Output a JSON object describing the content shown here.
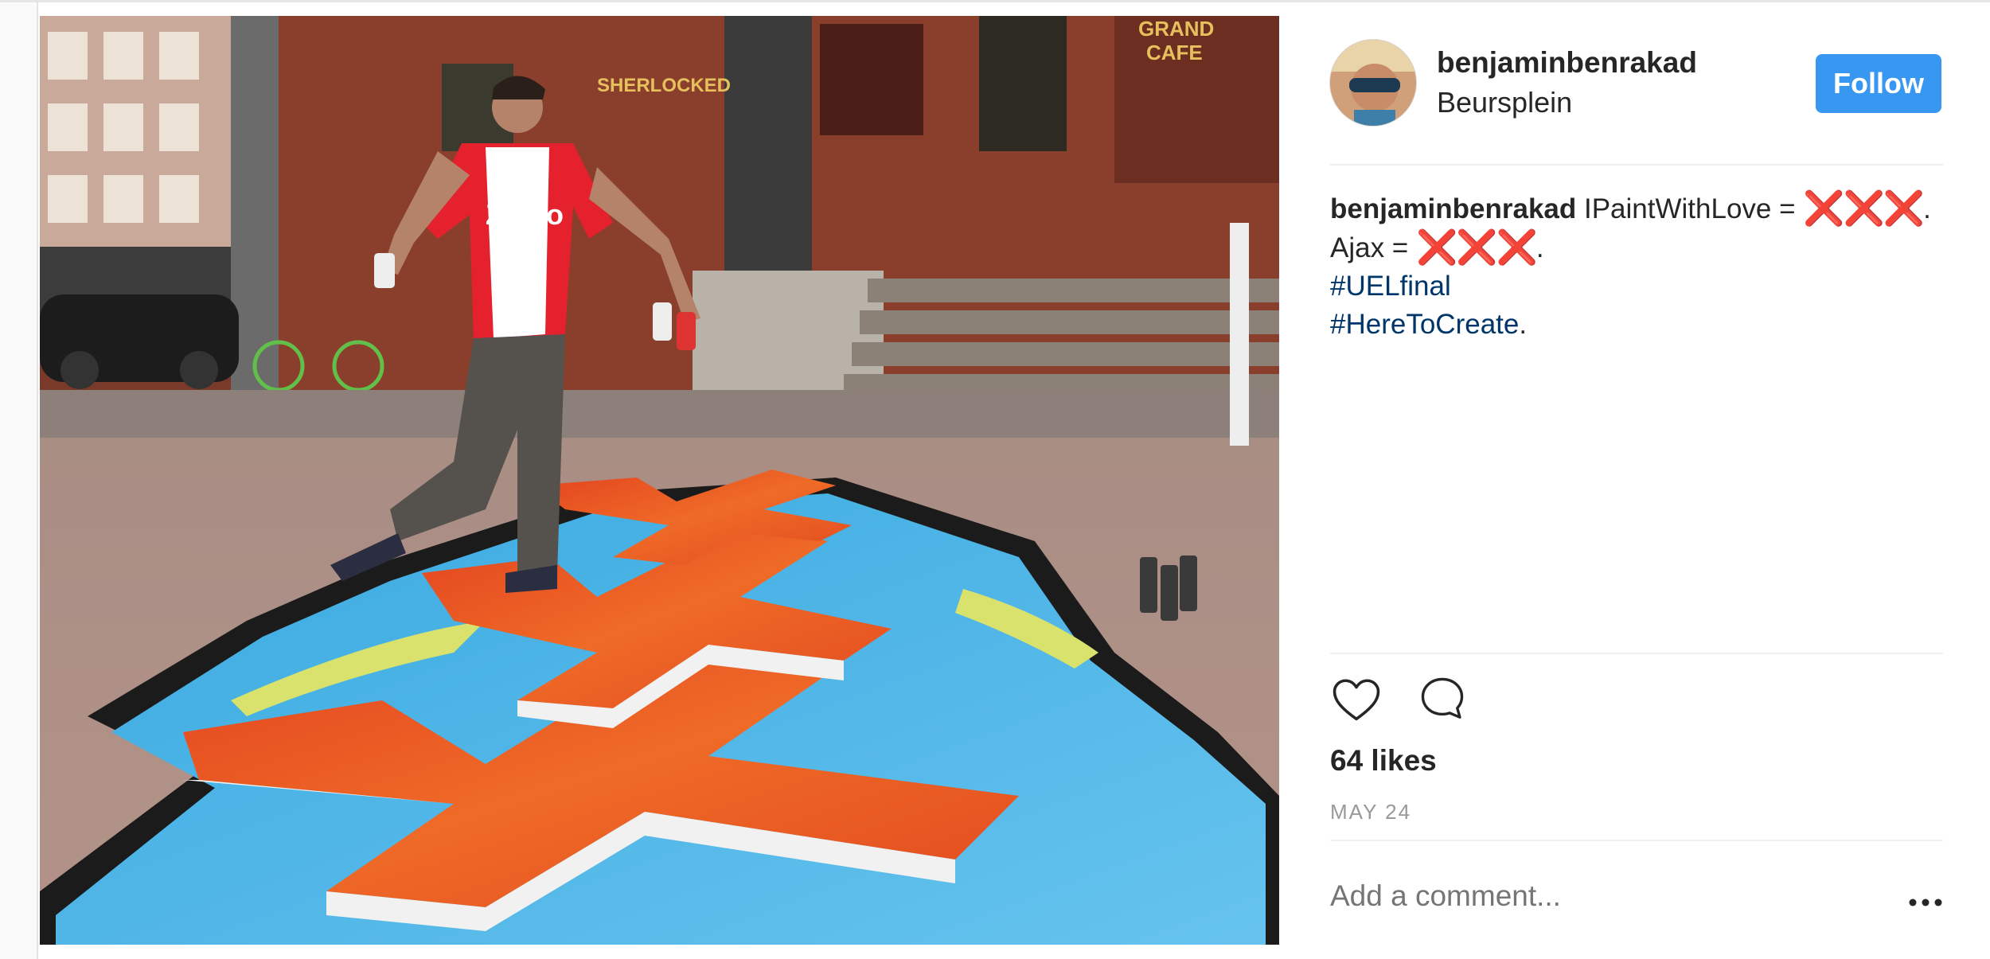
{
  "post": {
    "username": "benjaminbenrakad",
    "location": "Beursplein",
    "follow_label": "Follow",
    "caption": {
      "username": "benjaminbenrakad",
      "line1": " IPaintWithLove = ",
      "marks1": "❌❌❌",
      "end1": ".",
      "line2": "Ajax = ",
      "marks2": "❌❌❌",
      "end2": ".",
      "hashtag1": "#UELfinal",
      "hashtag2": "#HereToCreate",
      "end3": "."
    },
    "likes": "64 likes",
    "date": "MAY 24",
    "comment_placeholder": "Add a comment...",
    "photo_signs": {
      "shop1": "SHERLOCKED",
      "shop2a": "GRAND",
      "shop2b": "CAFE",
      "shirt": "Ziggo"
    }
  },
  "icons": {
    "like": "heart-outline-icon",
    "comment": "speech-bubble-icon",
    "more": "ellipsis-icon"
  },
  "colors": {
    "follow": "#3897f0",
    "hashtag": "#003569",
    "mark": "#e0141e"
  }
}
